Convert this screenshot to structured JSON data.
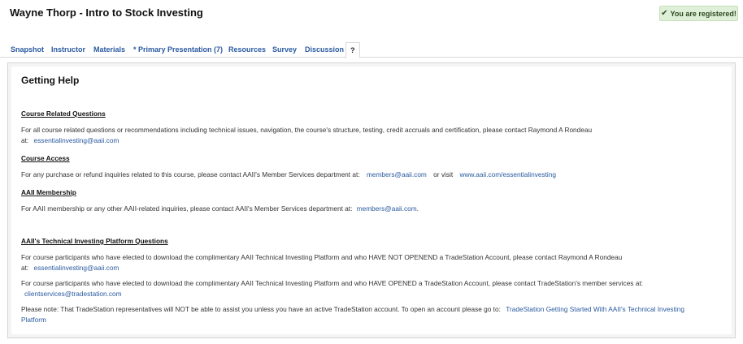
{
  "header": {
    "title": "Wayne Thorp - Intro to Stock Investing",
    "badge_icon": "check-icon",
    "badge_label": "You are registered!"
  },
  "tabs": [
    {
      "label": "Snapshot"
    },
    {
      "label": "Instructor"
    },
    {
      "label": "Materials"
    },
    {
      "label": "* Primary Presentation (7)"
    },
    {
      "label": "Resources"
    },
    {
      "label": "Survey"
    },
    {
      "label": "Discussion"
    },
    {
      "label": "?",
      "active": true
    }
  ],
  "colors": {
    "link": "#2a5aa0",
    "badge_background": "#dff0d8",
    "badge_text": "#2f4a22"
  },
  "content": {
    "title": "Getting Help",
    "course_questions": {
      "heading": "Course Related Questions",
      "text_line1": "For all course related questions or recommendations including technical issues, navigation, the course's structure, testing, credit accruals and certification, please contact Raymond A Rondeau",
      "at_label": "at:",
      "email": "essentialinvesting@aaii.com"
    },
    "course_access": {
      "heading": "Course Access",
      "text": "For any purchase or refund inquiries related to this course, please contact AAII's Member Services department at:",
      "email": "members@aaii.com",
      "or_visit": "or visit",
      "url": "www.aaii.com/essentialinvesting"
    },
    "membership": {
      "heading": "AAII Membership",
      "text": "For AAII membership or any other AAII-related inquiries, please contact AAII's Member Services department at:",
      "email": "members@aaii.com",
      "period": "."
    },
    "platform": {
      "heading": "AAII's Technical Investing Platform Questions",
      "p1_line1": "For course participants who have elected to download the complimentary AAII Technical Investing Platform and who HAVE NOT OPENEND a TradeStation Account, please contact Raymond A Rondeau",
      "p1_at": "at:",
      "p1_email": "essentialinvesting@aaii.com",
      "p2_line1": "For course participants who have elected to download the complimentary AAII Technical Investing Platform and who HAVE OPENED a TradeStation Account, please contact TradeStation's member services at:",
      "p2_email": "clientservices@tradestation.com",
      "p3_text": "Please note: That TradeStation representatives will NOT be able to assist you unless you have an active TradeStation account. To open an account please go to:",
      "p3_link_line1": "TradeStation Getting Started With AAII's Technical Investing",
      "p3_link_line2": "Platform"
    }
  }
}
